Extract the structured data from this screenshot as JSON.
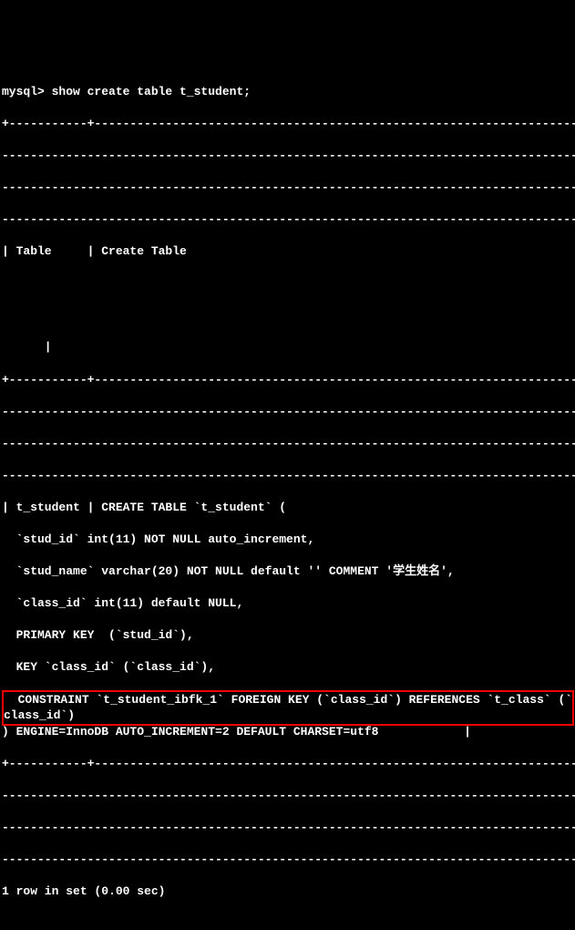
{
  "terminal": {
    "prompt": "mysql> show create table t_student;",
    "sep1": "+----------",
    "sep_long": "-+-----------------------------------------------------------------------------",
    "sep_plus": "-------+",
    "header_table": "| Table     | Create Table",
    "header_end": "      |",
    "row_start": "| t_student | CREATE TABLE `t_student` (",
    "def_line1": "  `stud_id` int(11) NOT NULL auto_increment,",
    "def_line2": "  `stud_name` varchar(20) NOT NULL default '' COMMENT '学生姓名',",
    "def_line3": "  `class_id` int(11) default NULL,",
    "def_line4": "  PRIMARY KEY  (`stud_id`),",
    "def_line5": "  KEY `class_id` (`class_id`),",
    "constraint_line": "  CONSTRAINT `t_student_ibfk_1` FOREIGN KEY (`class_id`) REFERENCES `t_class` (`",
    "constraint_cont": "class_id`)",
    "engine_line": ") ENGINE=InnoDB AUTO_INCREMENT=2 DEFAULT CHARSET=utf8            |",
    "result": "1 row in set (0.00 sec)"
  }
}
